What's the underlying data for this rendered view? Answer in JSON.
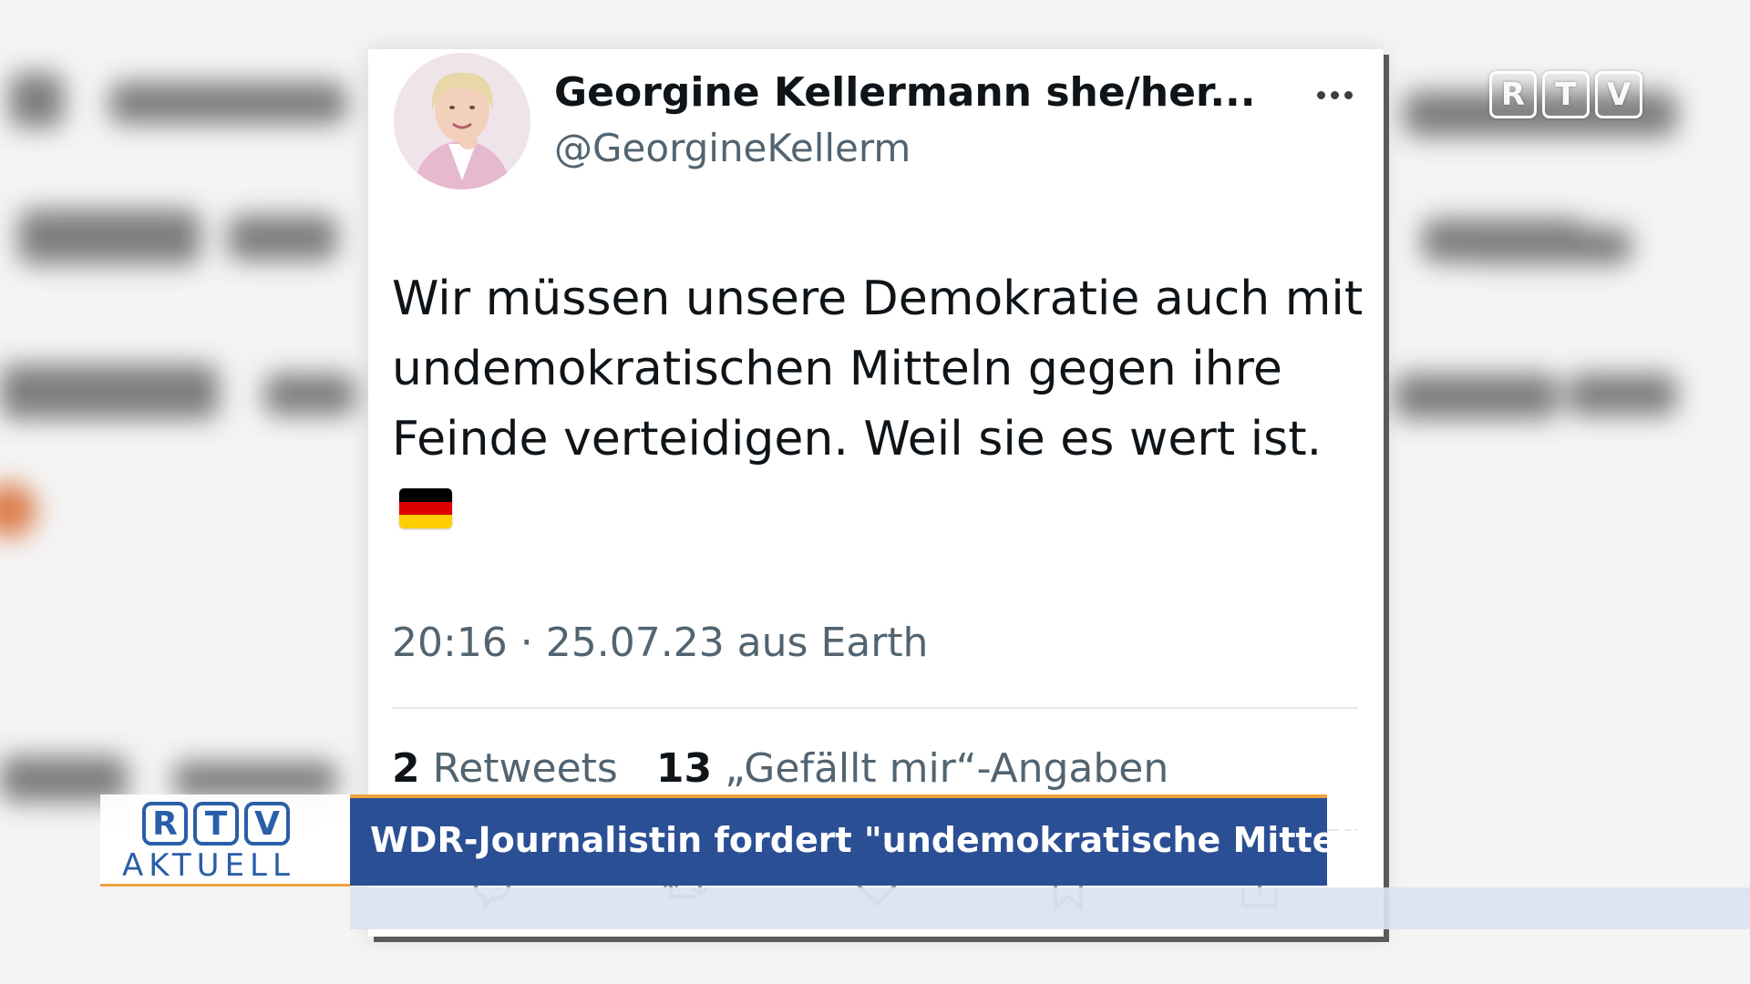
{
  "watermark": {
    "letters": [
      "R",
      "T",
      "V"
    ]
  },
  "tweet": {
    "display_name": "Georgine Kellermann she/her...",
    "handle": "@GeorgineKellerm",
    "text_lines": [
      "Wir müssen unsere Demokratie auch mit",
      "undemokratischen Mitteln gegen ihre",
      "Feinde verteidigen. Weil sie es wert ist."
    ],
    "flag_emoji": "german-flag",
    "timestamp": "20:16 · 25.07.23 aus Earth",
    "retweets_count": "2",
    "retweets_label": "Retweets",
    "likes_count": "13",
    "likes_label": "„Gefällt mir“-Angaben",
    "actions": [
      "reply-icon",
      "retweet-icon",
      "like-icon",
      "bookmark-icon",
      "share-icon"
    ]
  },
  "lower_third": {
    "logo_letters": [
      "R",
      "T",
      "V"
    ],
    "logo_subtitle": "AKTUELL",
    "headline": "WDR-Journalistin fordert \"undemokratische Mittel\"",
    "accent_color": "#f0a23a",
    "bar_color": "#2b4f95"
  },
  "colors": {
    "text_primary": "#0f1419",
    "text_secondary": "#536471",
    "flag": [
      "#000000",
      "#dd0000",
      "#ffce00"
    ]
  }
}
